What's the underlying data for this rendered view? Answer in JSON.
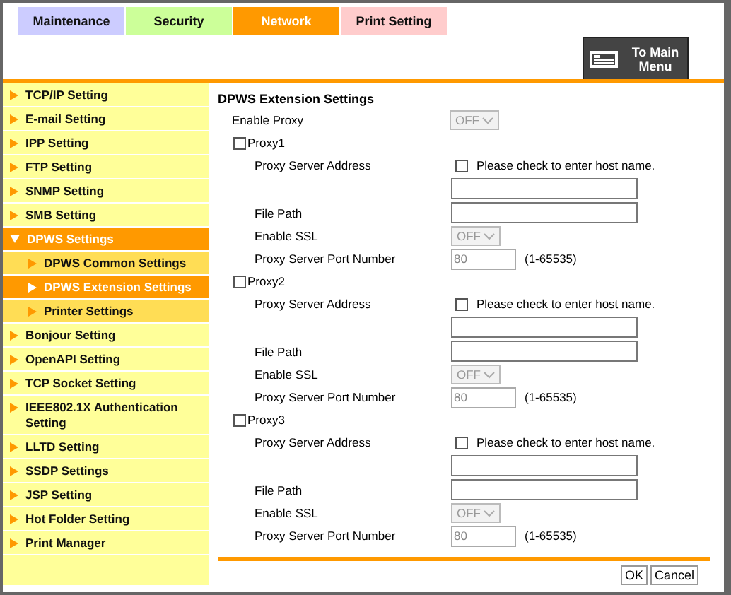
{
  "tabs": [
    {
      "label": "Maintenance",
      "selected": false,
      "color": "#ccccff"
    },
    {
      "label": "Security",
      "selected": false,
      "color": "#ccff99"
    },
    {
      "label": "Network",
      "selected": true,
      "color": "#ff9900"
    },
    {
      "label": "Print Setting",
      "selected": false,
      "color": "#ffcccc"
    }
  ],
  "main_menu_button": "To Main Menu",
  "sidebar": {
    "items": [
      {
        "label": "TCP/IP Setting",
        "selected": false
      },
      {
        "label": "E-mail Setting",
        "selected": false
      },
      {
        "label": "IPP Setting",
        "selected": false
      },
      {
        "label": "FTP Setting",
        "selected": false
      },
      {
        "label": "SNMP Setting",
        "selected": false
      },
      {
        "label": "SMB Setting",
        "selected": false
      },
      {
        "label": "DPWS Settings",
        "selected": true,
        "expanded": true,
        "children": [
          {
            "label": "DPWS Common Settings",
            "selected": false
          },
          {
            "label": "DPWS Extension Settings",
            "selected": true
          },
          {
            "label": "Printer Settings",
            "selected": false
          }
        ]
      },
      {
        "label": "Bonjour Setting",
        "selected": false
      },
      {
        "label": "OpenAPI Setting",
        "selected": false
      },
      {
        "label": "TCP Socket Setting",
        "selected": false
      },
      {
        "label": "IEEE802.1X Authentication Setting",
        "selected": false
      },
      {
        "label": "LLTD Setting",
        "selected": false
      },
      {
        "label": "SSDP Settings",
        "selected": false
      },
      {
        "label": "JSP Setting",
        "selected": false
      },
      {
        "label": "Hot Folder Setting",
        "selected": false
      },
      {
        "label": "Print Manager",
        "selected": false
      }
    ]
  },
  "form": {
    "title": "DPWS Extension Settings",
    "enable_proxy": {
      "label": "Enable Proxy",
      "value": "OFF",
      "disabled": true
    },
    "proxies": [
      {
        "label": "Proxy1",
        "checked": false,
        "address": {
          "label": "Proxy Server Address",
          "hostname_label": "Please check to enter host name.",
          "hostname_checked": false
        },
        "file_path": {
          "label": "File Path"
        },
        "ssl": {
          "label": "Enable SSL",
          "value": "OFF",
          "disabled": true
        },
        "port": {
          "label": "Proxy Server Port Number",
          "value": "80",
          "disabled": true,
          "range": "(1-65535)"
        }
      },
      {
        "label": "Proxy2",
        "checked": false,
        "address": {
          "label": "Proxy Server Address",
          "hostname_label": "Please check to enter host name.",
          "hostname_checked": false
        },
        "file_path": {
          "label": "File Path"
        },
        "ssl": {
          "label": "Enable SSL",
          "value": "OFF",
          "disabled": true
        },
        "port": {
          "label": "Proxy Server Port Number",
          "value": "80",
          "disabled": true,
          "range": "(1-65535)"
        }
      },
      {
        "label": "Proxy3",
        "checked": false,
        "address": {
          "label": "Proxy Server Address",
          "hostname_label": "Please check to enter host name.",
          "hostname_checked": false
        },
        "file_path": {
          "label": "File Path"
        },
        "ssl": {
          "label": "Enable SSL",
          "value": "OFF",
          "disabled": true
        },
        "port": {
          "label": "Proxy Server Port Number",
          "value": "80",
          "disabled": true,
          "range": "(1-65535)"
        }
      }
    ]
  },
  "buttons": [
    {
      "label": "OK"
    },
    {
      "label": "Cancel"
    }
  ]
}
